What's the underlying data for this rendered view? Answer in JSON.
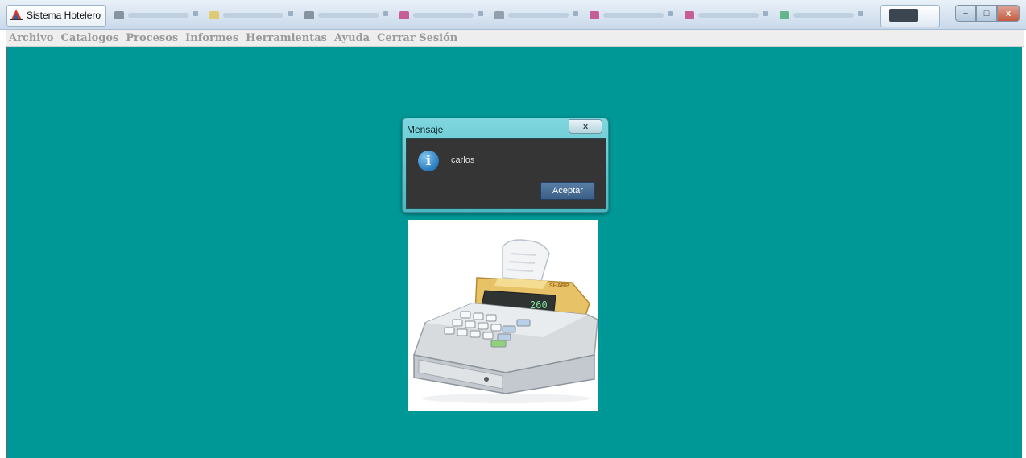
{
  "window": {
    "title": "Sistema Hotelero",
    "controls": {
      "minimize": "–",
      "maximize": "□",
      "close": "x"
    }
  },
  "menubar": {
    "items": [
      "Archivo",
      "Catalogos",
      "Procesos",
      "Informes",
      "Herramientas",
      "Ayuda",
      "Cerrar Sesión"
    ]
  },
  "dialog": {
    "title": "Mensaje",
    "close_glyph": "x",
    "message": "carlos",
    "icon_glyph": "i",
    "ok_label": "Aceptar"
  },
  "content": {
    "background": "#009797",
    "image": "cash-register-illustration",
    "register_display": "260",
    "register_brand": "SHARP"
  }
}
